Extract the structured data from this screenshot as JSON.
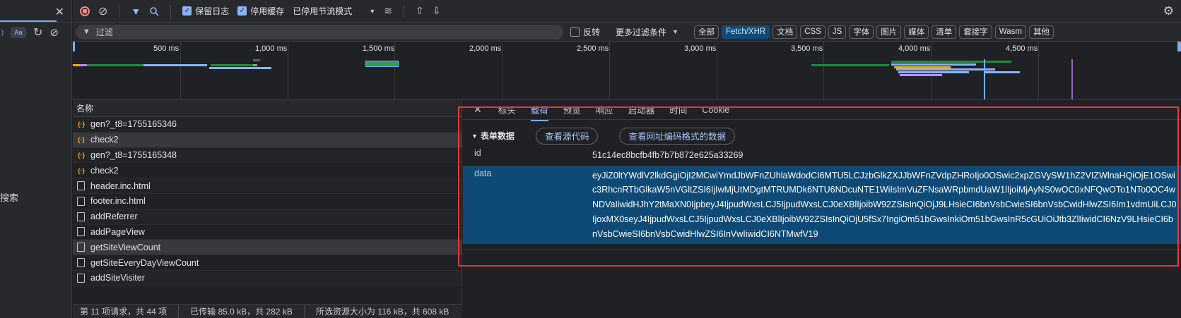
{
  "left_panel": {
    "aa_label": "Aa",
    "search_label": "搜索"
  },
  "toolbar": {
    "preserve_log": "保留日志",
    "disable_cache": "停用缓存",
    "throttle": "已停用节流模式"
  },
  "filter": {
    "placeholder": "过滤",
    "invert": "反转",
    "more_filters": "更多过滤条件",
    "types": [
      "全部",
      "Fetch/XHR",
      "文档",
      "CSS",
      "JS",
      "字体",
      "图片",
      "媒体",
      "清单",
      "套接字",
      "Wasm",
      "其他"
    ]
  },
  "overview": {
    "ticks": [
      "500 ms",
      "1,000 ms",
      "1,500 ms",
      "2,000 ms",
      "2,500 ms",
      "3,000 ms",
      "3,500 ms",
      "4,000 ms",
      "4,500 ms"
    ]
  },
  "request_list": {
    "header": "名称",
    "rows": [
      {
        "name": "gen?_t8=1755165346",
        "type": "xhr"
      },
      {
        "name": "check2",
        "type": "xhr"
      },
      {
        "name": "gen?_t8=1755165348",
        "type": "xhr"
      },
      {
        "name": "check2",
        "type": "xhr"
      },
      {
        "name": "header.inc.html",
        "type": "doc"
      },
      {
        "name": "footer.inc.html",
        "type": "doc"
      },
      {
        "name": "addReferrer",
        "type": "doc"
      },
      {
        "name": "addPageView",
        "type": "doc"
      },
      {
        "name": "getSiteViewCount",
        "type": "doc"
      },
      {
        "name": "getSiteEveryDayViewCount",
        "type": "doc"
      },
      {
        "name": "addSiteVisiter",
        "type": "doc"
      }
    ],
    "status": [
      "第 11 项请求，共 44 项",
      "已传输 85.0 kB，共 282 kB",
      "所选资源大小为 116 kB，共 608 kB"
    ]
  },
  "details": {
    "tabs": [
      "标头",
      "载荷",
      "预览",
      "响应",
      "启动器",
      "时间",
      "Cookie"
    ],
    "active_tab": "载荷",
    "section_title": "表单数据",
    "view_source": "查看源代码",
    "view_url_encoded": "查看网址编码格式的数据",
    "fields": [
      {
        "key": "id",
        "value": "51c14ec8bcfb4fb7b7b872e625a33269"
      },
      {
        "key": "data",
        "value": "eyJiZ0ltYWdlV2lkdGgiOjI2MCwiYmdJbWFnZUhlaWdodCI6MTU5LCJzbGlkZXJJbWFnZVdpZHRoIjo0OSwic2xpZGVySW1hZ2VIZWlnaHQiOjE1OSwic3RhcnRTbGlkaW5nVGltZSI6IjIwMjUtMDgtMTRUMDk6NTU6NDcuNTE1WiIsImVuZFNsaWRpbmdUaW1lIjoiMjAyNS0wOC0xNFQwOTo1NTo0OC4wNDVaIiwidHJhY2tMaXN0IjpbeyJ4IjpudWxsLCJ5IjpudWxsLCJ0eXBlIjoibW92ZSIsInQiOjJ9LHsieCI6bnVsbCwieSI6bnVsbCwidHlwZSI6Im1vdmUiLCJ0IjoxMX0seyJ4IjpudWxsLCJ5IjpudWxsLCJ0eXBlIjoibW92ZSIsInQiOjU5fSx7IngiOm51bGwsInkiOm51bGwsInR5cGUiOiJtb3ZlIiwidCI6NzV9LHsieCI6bnVsbCwieSI6bnVsbCwidHlwZSI6InVwIiwidCI6NTMwfV19"
      }
    ]
  }
}
